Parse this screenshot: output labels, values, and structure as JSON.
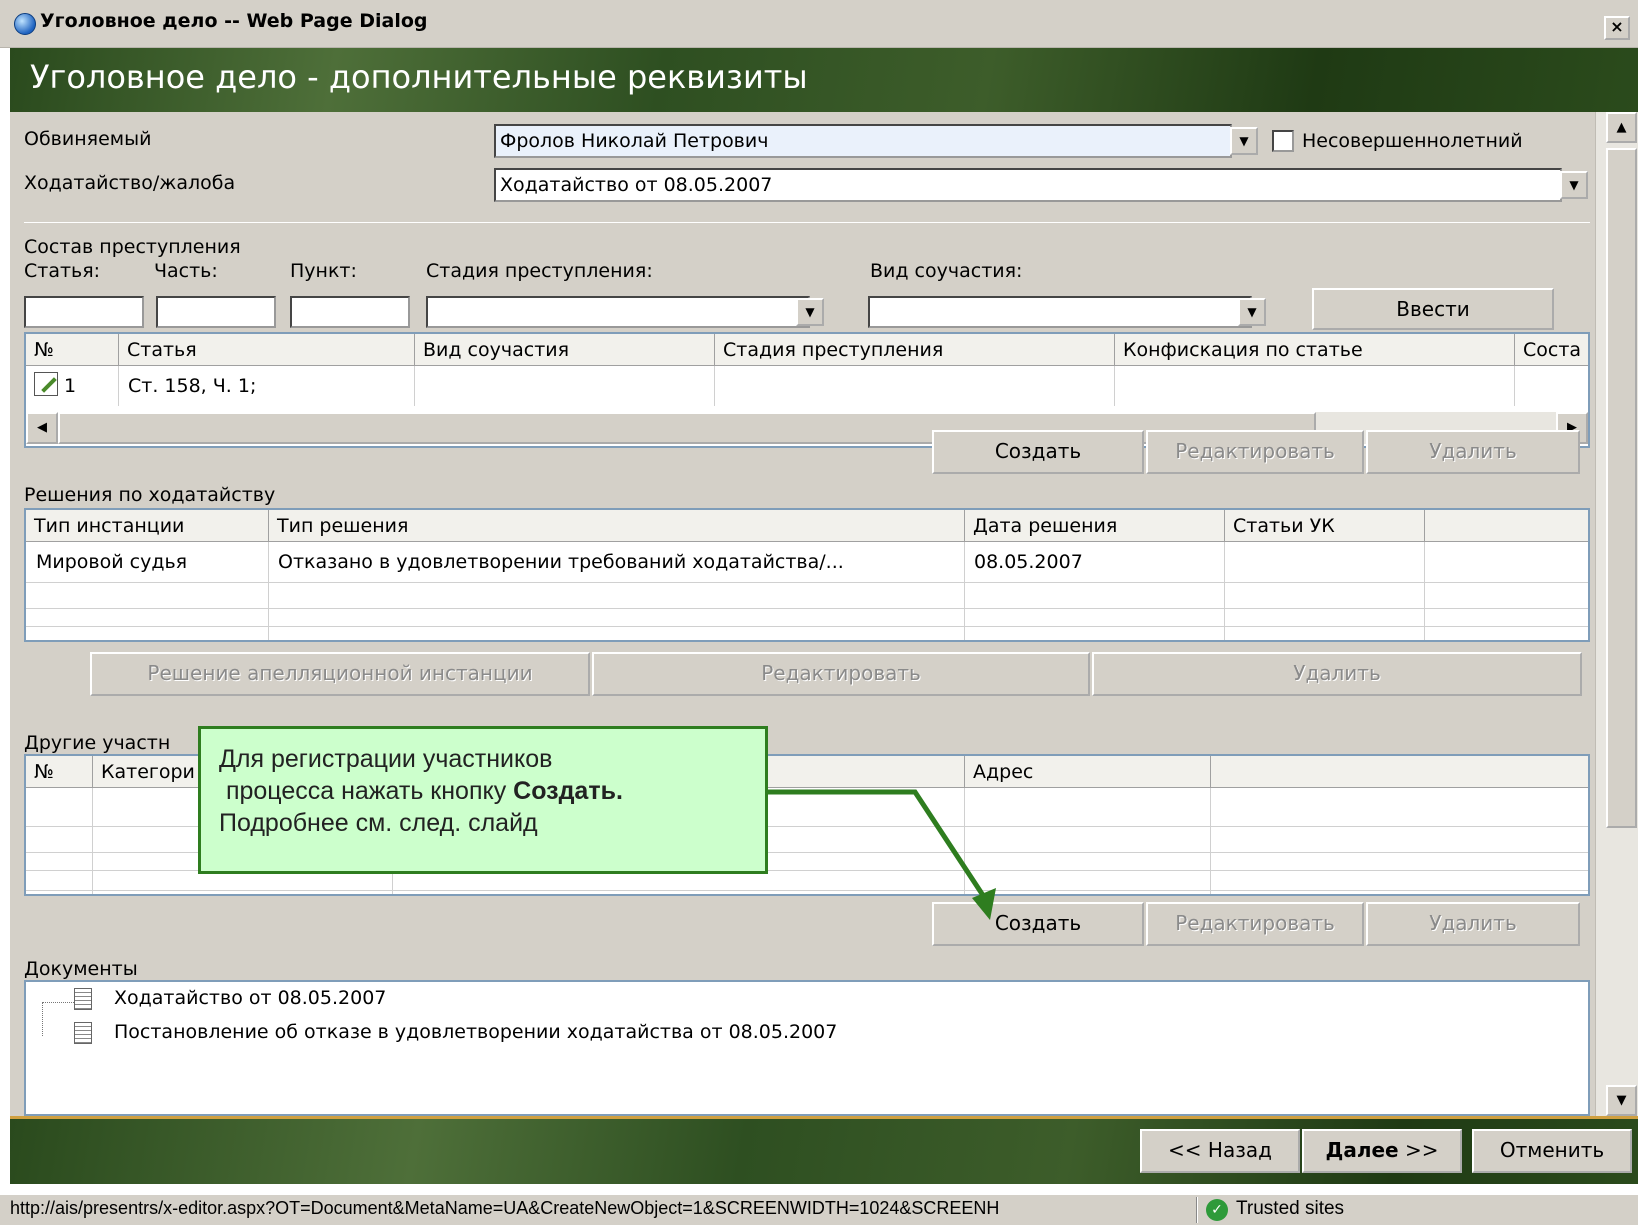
{
  "window": {
    "title": "Уголовное дело -- Web Page Dialog",
    "close_label": "×"
  },
  "header": {
    "title": "Уголовное дело - дополнительные реквизиты"
  },
  "accused": {
    "label": "Обвиняемый",
    "value": "Фролов Николай Петрович",
    "minor_label": "Несовершеннолетний"
  },
  "petition": {
    "label": "Ходатайство/жалоба",
    "value": "Ходатайство от 08.05.2007"
  },
  "crime": {
    "section_label": "Состав преступления",
    "article_label": "Статья:",
    "part_label": "Часть:",
    "item_label": "Пункт:",
    "stage_label": "Стадия преступления:",
    "complicity_label": "Вид соучастия:",
    "enter_button": "Ввести",
    "columns": [
      "№",
      "Статья",
      "Вид соучастия",
      "Стадия преступления",
      "Конфискация по статье",
      "Соста"
    ],
    "rows": [
      {
        "num": "1",
        "article": "Ст. 158, Ч. 1;"
      }
    ],
    "buttons": {
      "create": "Создать",
      "edit": "Редактировать",
      "delete": "Удалить"
    }
  },
  "decisions": {
    "section_label": "Решения по ходатайству",
    "columns": [
      "Тип инстанции",
      "Тип решения",
      "Дата решения",
      "Статьи УК"
    ],
    "rows": [
      {
        "instance": "Мировой судья",
        "type": "Отказано в удовлетворении требований ходатайства/...",
        "date": "08.05.2007",
        "articles": ""
      }
    ],
    "buttons": {
      "appeal": "Решение апелляционной инстанции",
      "edit": "Редактировать",
      "delete": "Удалить"
    }
  },
  "participants": {
    "section_label": "Другие участн",
    "columns": [
      "№",
      "Категори",
      "Адрес"
    ],
    "buttons": {
      "create": "Создать",
      "edit": "Редактировать",
      "delete": "Удалить"
    }
  },
  "documents": {
    "section_label": "Документы",
    "items": [
      "Ходатайство от 08.05.2007",
      "Постановление об отказе в удовлетворении ходатайства от 08.05.2007"
    ]
  },
  "callout": {
    "line1": "Для регистрации участников",
    "line2_prefix": " процесса нажать кнопку ",
    "line2_bold": "Создать.",
    "line3": "Подробнее см. след. слайд"
  },
  "footer": {
    "back": "<< Назад",
    "next_bold": "Далее",
    "next_suffix": " >>",
    "cancel": "Отменить"
  },
  "statusbar": {
    "url": "http://ais/presentrs/x-editor.aspx?OT=Document&MetaName=UA&CreateNewObject=1&SCREENWIDTH=1024&SCREENH",
    "zone": "Trusted sites"
  },
  "colors": {
    "window_bg": "#d4d0c8",
    "header_green": "#2e4f21",
    "callout_bg": "#ccffcc",
    "callout_border": "#2e7d1f"
  }
}
